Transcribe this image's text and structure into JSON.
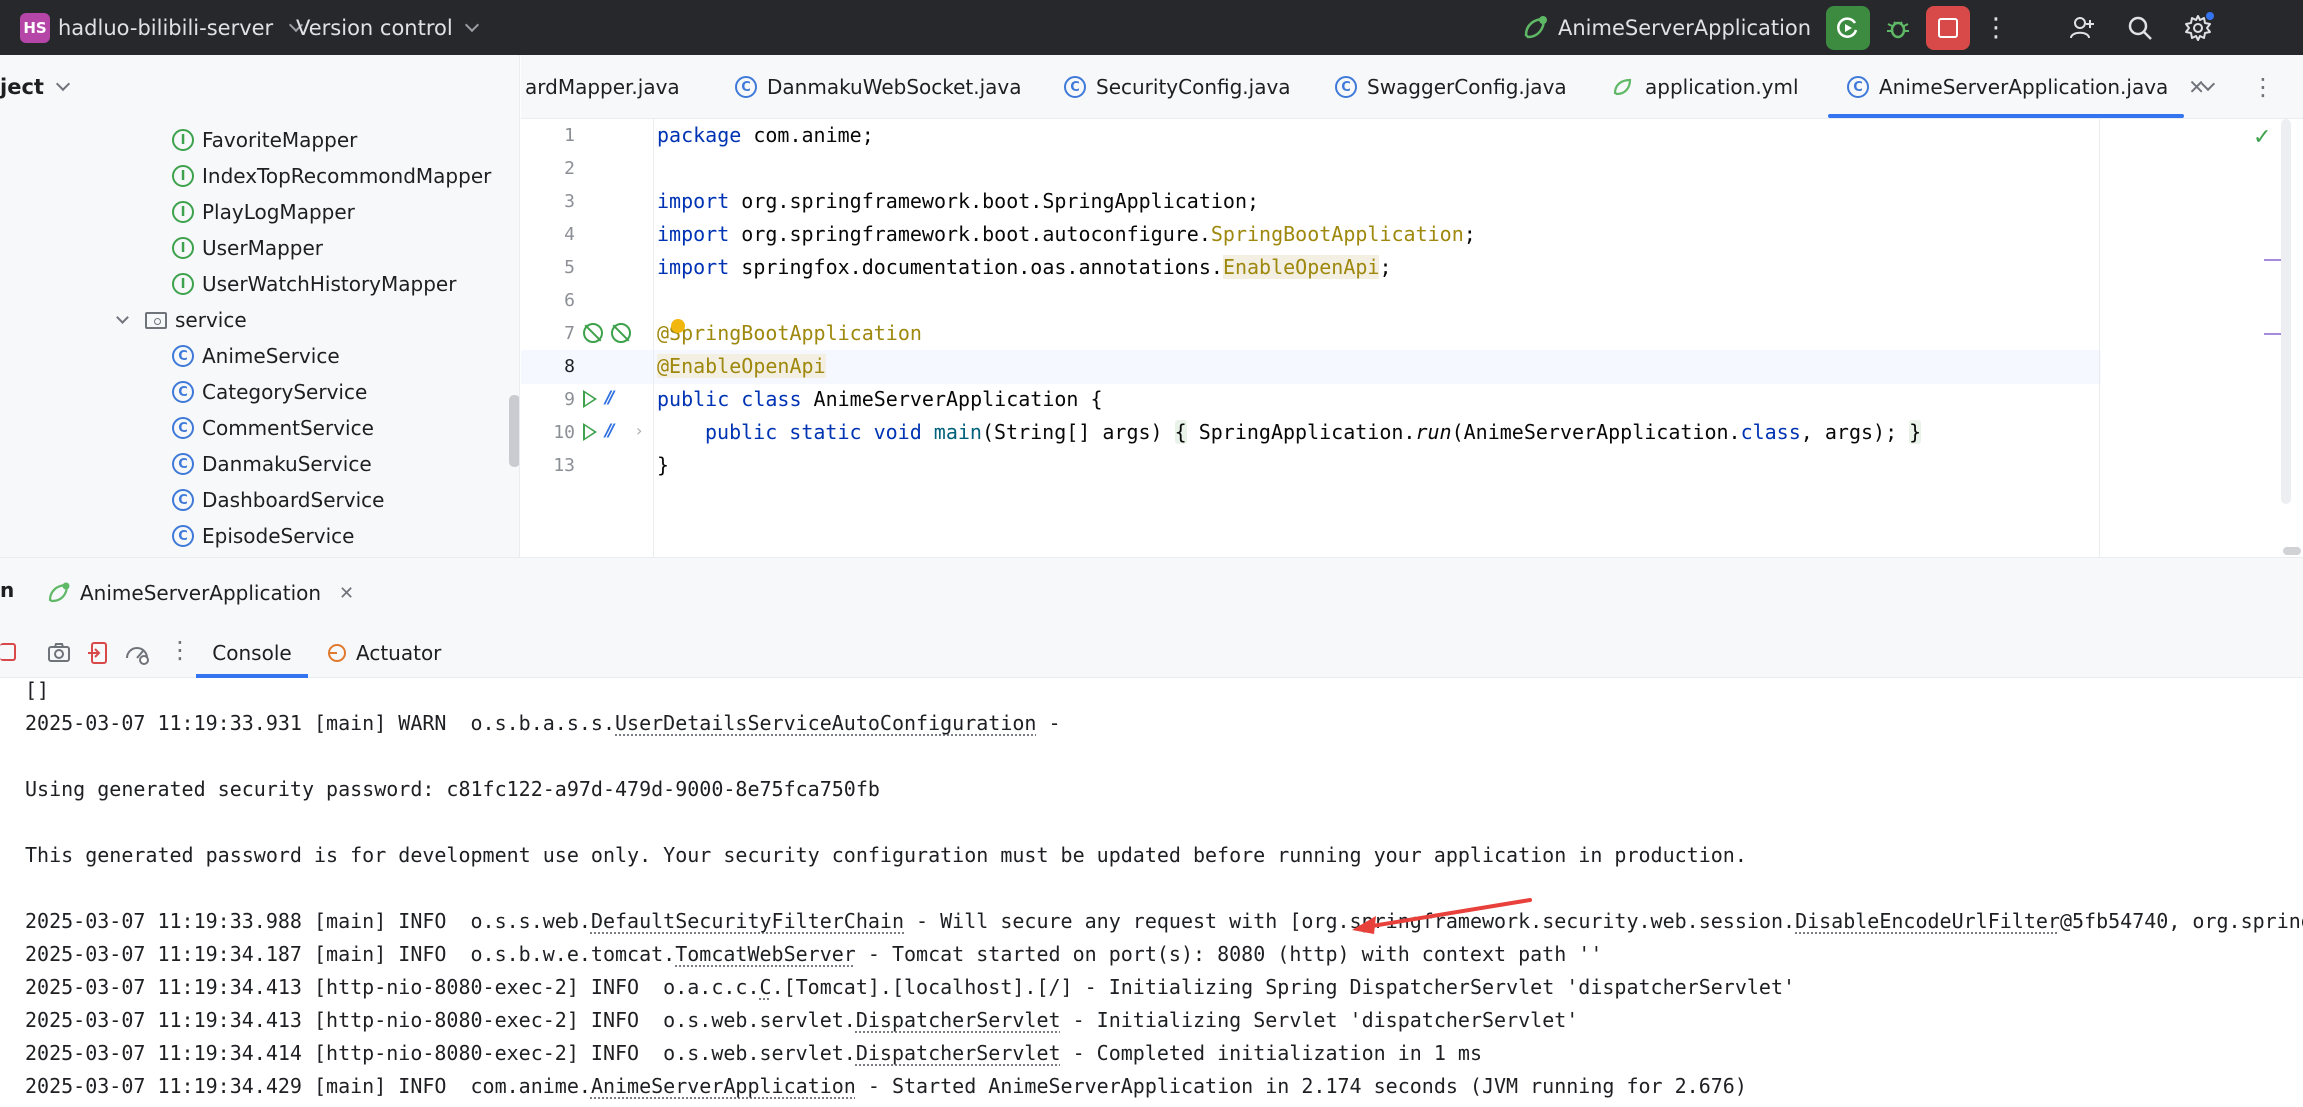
{
  "titlebar": {
    "project_badge": "HS",
    "project_name": "hadluo-bilibili-server",
    "version_control": "Version control",
    "run_config": "AnimeServerApplication"
  },
  "project_panel": {
    "header": "ject",
    "items": [
      {
        "label": "FavoriteMapper",
        "kind": "I"
      },
      {
        "label": "IndexTopRecommondMapper",
        "kind": "I"
      },
      {
        "label": "PlayLogMapper",
        "kind": "I"
      },
      {
        "label": "UserMapper",
        "kind": "I"
      },
      {
        "label": "UserWatchHistoryMapper",
        "kind": "I"
      },
      {
        "label": "service",
        "kind": "folder"
      },
      {
        "label": "AnimeService",
        "kind": "C"
      },
      {
        "label": "CategoryService",
        "kind": "C"
      },
      {
        "label": "CommentService",
        "kind": "C"
      },
      {
        "label": "DanmakuService",
        "kind": "C"
      },
      {
        "label": "DashboardService",
        "kind": "C"
      },
      {
        "label": "EpisodeService",
        "kind": "C"
      }
    ]
  },
  "tabs": [
    {
      "label": "ardMapper.java"
    },
    {
      "label": "DanmakuWebSocket.java"
    },
    {
      "label": "SecurityConfig.java"
    },
    {
      "label": "SwaggerConfig.java"
    },
    {
      "label": "application.yml"
    },
    {
      "label": "AnimeServerApplication.java"
    }
  ],
  "editor": {
    "line_numbers": [
      "1",
      "2",
      "3",
      "4",
      "5",
      "6",
      "7",
      "8",
      "9",
      "10",
      "13"
    ],
    "code": {
      "l1_kw": "package",
      "l1_rest": " com.anime;",
      "l3_kw": "import",
      "l3_rest": " org.springframework.boot.SpringApplication;",
      "l4_kw": "import",
      "l4_rest": " org.springframework.boot.autoconfigure.",
      "l4_ann": "SpringBootApplication",
      "l4_end": ";",
      "l5_kw": "import",
      "l5_rest": " springfox.documentation.oas.annotations.",
      "l5_ann": "EnableOpenApi",
      "l5_end": ";",
      "l7": "@SpringBootApplication",
      "l8": "@EnableOpenApi",
      "l9_kw": "public class",
      "l9_rest": " AnimeServerApplication {",
      "l10_kw": "public static void",
      "l10_fn": "main",
      "l10_args": "(String[] args) ",
      "l10_open": "{",
      "l10_call1": " SpringApplication.",
      "l10_run": "run",
      "l10_call2": "(AnimeServerApplication.",
      "l10_class": "class",
      "l10_call3": ", args); ",
      "l10_close": "}",
      "l13": "}"
    }
  },
  "run_panel": {
    "run_tab": "AnimeServerApplication",
    "console_tab": "Console",
    "actuator_tab": "Actuator",
    "lines": {
      "l0": "[]",
      "l1_pre": "2025-03-07 11:19:33.931 [main] WARN  o.s.b.a.s.s.",
      "l1_cls": "UserDetailsServiceAutoConfiguration",
      "l1_post": " -",
      "l2": "Using generated security password: c81fc122-a97d-479d-9000-8e75fca750fb",
      "l3": "This generated password is for development use only. Your security configuration must be updated before running your application in production.",
      "l4_pre": "2025-03-07 11:19:33.988 [main] INFO  o.s.s.web.",
      "l4_cls": "DefaultSecurityFilterChain",
      "l4_mid": " - Will secure any request with [org.springframework.security.web.session.",
      "l4_cls2": "DisableEncodeUrlFilter",
      "l4_post": "@5fb54740, org.spring",
      "l5_pre": "2025-03-07 11:19:34.187 [main] INFO  o.s.b.w.e.tomcat.",
      "l5_cls": "TomcatWebServer",
      "l5_post": " - Tomcat started on port(s): 8080 (http) with context path ''",
      "l6_pre": "2025-03-07 11:19:34.413 [http-nio-8080-exec-2] INFO  o.a.c.c.",
      "l6_cls": "C",
      "l6_post": ".[Tomcat].[localhost].[/] - Initializing Spring DispatcherServlet 'dispatcherServlet'",
      "l7_pre": "2025-03-07 11:19:34.413 [http-nio-8080-exec-2] INFO  o.s.web.servlet.",
      "l7_cls": "DispatcherServlet",
      "l7_post": " - Initializing Servlet 'dispatcherServlet'",
      "l8_pre": "2025-03-07 11:19:34.414 [http-nio-8080-exec-2] INFO  o.s.web.servlet.",
      "l8_cls": "DispatcherServlet",
      "l8_post": " - Completed initialization in 1 ms",
      "l9_pre": "2025-03-07 11:19:34.429 [main] INFO  com.anime.",
      "l9_cls": "AnimeServerApplication",
      "l9_post": " - Started AnimeServerApplication in 2.174 seconds (JVM running for 2.676)"
    }
  },
  "colors": {
    "titlebar_bg": "#27282c",
    "accent": "#3574f0",
    "run_green": "#3ea24c",
    "stop_red": "#d84a4a",
    "annotation": "#9e880d",
    "keyword": "#0033b3"
  }
}
